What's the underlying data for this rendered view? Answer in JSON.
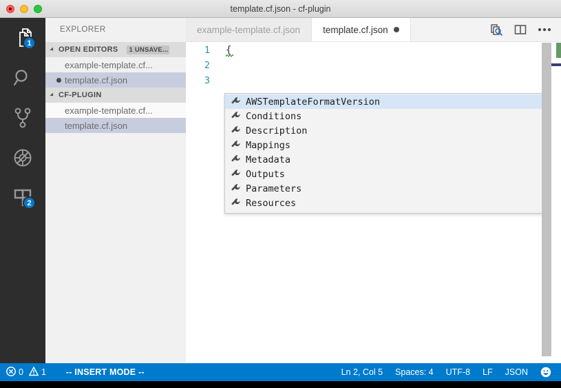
{
  "window": {
    "title": "template.cf.json - cf-plugin",
    "traffic_lights": [
      "close-button",
      "minimize-button",
      "maximize-button"
    ]
  },
  "activitybar": {
    "items": [
      {
        "name": "explorer",
        "icon": "files-icon",
        "badge": "1",
        "active": true
      },
      {
        "name": "search",
        "icon": "search-icon",
        "badge": "",
        "active": false
      },
      {
        "name": "source-control",
        "icon": "source-control-icon",
        "badge": "",
        "active": false
      },
      {
        "name": "debug",
        "icon": "debug-icon",
        "badge": "",
        "active": false
      },
      {
        "name": "extensions",
        "icon": "extensions-icon",
        "badge": "2",
        "active": false
      }
    ]
  },
  "sidebar": {
    "title": "EXPLORER",
    "sections": [
      {
        "label": "OPEN EDITORS",
        "badge": "1 UNSAVE...",
        "rows": [
          {
            "label": "example-template.cf...",
            "dirty": false,
            "selected": false
          },
          {
            "label": "template.cf.json",
            "dirty": true,
            "selected": true
          }
        ]
      },
      {
        "label": "CF-PLUGIN",
        "badge": "",
        "rows": [
          {
            "label": "example-template.cf...",
            "dirty": false,
            "selected": false
          },
          {
            "label": "template.cf.json",
            "dirty": false,
            "selected": true
          }
        ]
      }
    ]
  },
  "tabs": [
    {
      "label": "example-template.cf.json",
      "active": false,
      "dirty": false
    },
    {
      "label": "template.cf.json",
      "active": true,
      "dirty": true
    }
  ],
  "tab_actions": [
    {
      "name": "open-preview-icon"
    },
    {
      "name": "split-editor-icon"
    },
    {
      "name": "more-actions-icon"
    }
  ],
  "editor": {
    "lines": [
      {
        "number": "1",
        "text": "{",
        "squiggle": true
      },
      {
        "number": "2",
        "text": "",
        "squiggle": false
      },
      {
        "number": "3",
        "text": "",
        "squiggle": false
      }
    ]
  },
  "suggest": {
    "items": [
      {
        "label": "AWSTemplateFormatVersion",
        "icon": "property-wrench-icon",
        "selected": true
      },
      {
        "label": "Conditions",
        "icon": "property-wrench-icon",
        "selected": false
      },
      {
        "label": "Description",
        "icon": "property-wrench-icon",
        "selected": false
      },
      {
        "label": "Mappings",
        "icon": "property-wrench-icon",
        "selected": false
      },
      {
        "label": "Metadata",
        "icon": "property-wrench-icon",
        "selected": false
      },
      {
        "label": "Outputs",
        "icon": "property-wrench-icon",
        "selected": false
      },
      {
        "label": "Parameters",
        "icon": "property-wrench-icon",
        "selected": false
      },
      {
        "label": "Resources",
        "icon": "property-wrench-icon",
        "selected": false
      }
    ]
  },
  "statusbar": {
    "errors": "0",
    "warnings": "1",
    "mode": "-- INSERT MODE --",
    "position": "Ln 2, Col 5",
    "indentation": "Spaces: 4",
    "encoding": "UTF-8",
    "eol": "LF",
    "language": "JSON",
    "feedback_icon": "smiley-icon"
  },
  "colors": {
    "accent": "#007acc",
    "activitybar_bg": "#2d2d2d",
    "sidebar_bg": "#f1f1f1",
    "editor_bg": "#ffffff",
    "suggest_selected": "#d6e6f7",
    "tree_selected": "#c7cddf",
    "line_number": "#2b91af",
    "overview_green": "#669966"
  }
}
